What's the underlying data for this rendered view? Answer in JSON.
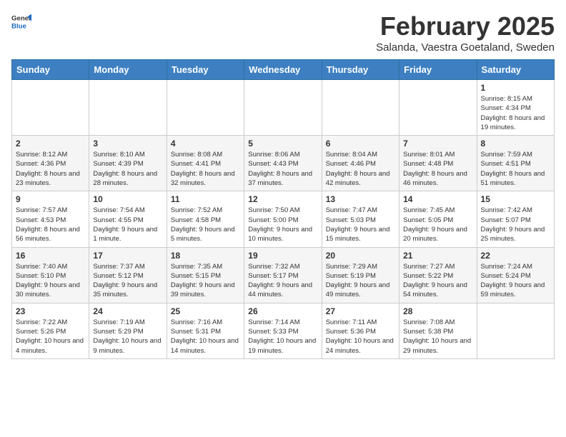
{
  "logo": {
    "text_general": "General",
    "text_blue": "Blue"
  },
  "header": {
    "title": "February 2025",
    "subtitle": "Salanda, Vaestra Goetaland, Sweden"
  },
  "weekdays": [
    "Sunday",
    "Monday",
    "Tuesday",
    "Wednesday",
    "Thursday",
    "Friday",
    "Saturday"
  ],
  "weeks": [
    [
      {
        "day": "",
        "info": ""
      },
      {
        "day": "",
        "info": ""
      },
      {
        "day": "",
        "info": ""
      },
      {
        "day": "",
        "info": ""
      },
      {
        "day": "",
        "info": ""
      },
      {
        "day": "",
        "info": ""
      },
      {
        "day": "1",
        "info": "Sunrise: 8:15 AM\nSunset: 4:34 PM\nDaylight: 8 hours and 19 minutes."
      }
    ],
    [
      {
        "day": "2",
        "info": "Sunrise: 8:12 AM\nSunset: 4:36 PM\nDaylight: 8 hours and 23 minutes."
      },
      {
        "day": "3",
        "info": "Sunrise: 8:10 AM\nSunset: 4:39 PM\nDaylight: 8 hours and 28 minutes."
      },
      {
        "day": "4",
        "info": "Sunrise: 8:08 AM\nSunset: 4:41 PM\nDaylight: 8 hours and 32 minutes."
      },
      {
        "day": "5",
        "info": "Sunrise: 8:06 AM\nSunset: 4:43 PM\nDaylight: 8 hours and 37 minutes."
      },
      {
        "day": "6",
        "info": "Sunrise: 8:04 AM\nSunset: 4:46 PM\nDaylight: 8 hours and 42 minutes."
      },
      {
        "day": "7",
        "info": "Sunrise: 8:01 AM\nSunset: 4:48 PM\nDaylight: 8 hours and 46 minutes."
      },
      {
        "day": "8",
        "info": "Sunrise: 7:59 AM\nSunset: 4:51 PM\nDaylight: 8 hours and 51 minutes."
      }
    ],
    [
      {
        "day": "9",
        "info": "Sunrise: 7:57 AM\nSunset: 4:53 PM\nDaylight: 8 hours and 56 minutes."
      },
      {
        "day": "10",
        "info": "Sunrise: 7:54 AM\nSunset: 4:55 PM\nDaylight: 9 hours and 1 minute."
      },
      {
        "day": "11",
        "info": "Sunrise: 7:52 AM\nSunset: 4:58 PM\nDaylight: 9 hours and 5 minutes."
      },
      {
        "day": "12",
        "info": "Sunrise: 7:50 AM\nSunset: 5:00 PM\nDaylight: 9 hours and 10 minutes."
      },
      {
        "day": "13",
        "info": "Sunrise: 7:47 AM\nSunset: 5:03 PM\nDaylight: 9 hours and 15 minutes."
      },
      {
        "day": "14",
        "info": "Sunrise: 7:45 AM\nSunset: 5:05 PM\nDaylight: 9 hours and 20 minutes."
      },
      {
        "day": "15",
        "info": "Sunrise: 7:42 AM\nSunset: 5:07 PM\nDaylight: 9 hours and 25 minutes."
      }
    ],
    [
      {
        "day": "16",
        "info": "Sunrise: 7:40 AM\nSunset: 5:10 PM\nDaylight: 9 hours and 30 minutes."
      },
      {
        "day": "17",
        "info": "Sunrise: 7:37 AM\nSunset: 5:12 PM\nDaylight: 9 hours and 35 minutes."
      },
      {
        "day": "18",
        "info": "Sunrise: 7:35 AM\nSunset: 5:15 PM\nDaylight: 9 hours and 39 minutes."
      },
      {
        "day": "19",
        "info": "Sunrise: 7:32 AM\nSunset: 5:17 PM\nDaylight: 9 hours and 44 minutes."
      },
      {
        "day": "20",
        "info": "Sunrise: 7:29 AM\nSunset: 5:19 PM\nDaylight: 9 hours and 49 minutes."
      },
      {
        "day": "21",
        "info": "Sunrise: 7:27 AM\nSunset: 5:22 PM\nDaylight: 9 hours and 54 minutes."
      },
      {
        "day": "22",
        "info": "Sunrise: 7:24 AM\nSunset: 5:24 PM\nDaylight: 9 hours and 59 minutes."
      }
    ],
    [
      {
        "day": "23",
        "info": "Sunrise: 7:22 AM\nSunset: 5:26 PM\nDaylight: 10 hours and 4 minutes."
      },
      {
        "day": "24",
        "info": "Sunrise: 7:19 AM\nSunset: 5:29 PM\nDaylight: 10 hours and 9 minutes."
      },
      {
        "day": "25",
        "info": "Sunrise: 7:16 AM\nSunset: 5:31 PM\nDaylight: 10 hours and 14 minutes."
      },
      {
        "day": "26",
        "info": "Sunrise: 7:14 AM\nSunset: 5:33 PM\nDaylight: 10 hours and 19 minutes."
      },
      {
        "day": "27",
        "info": "Sunrise: 7:11 AM\nSunset: 5:36 PM\nDaylight: 10 hours and 24 minutes."
      },
      {
        "day": "28",
        "info": "Sunrise: 7:08 AM\nSunset: 5:38 PM\nDaylight: 10 hours and 29 minutes."
      },
      {
        "day": "",
        "info": ""
      }
    ]
  ]
}
